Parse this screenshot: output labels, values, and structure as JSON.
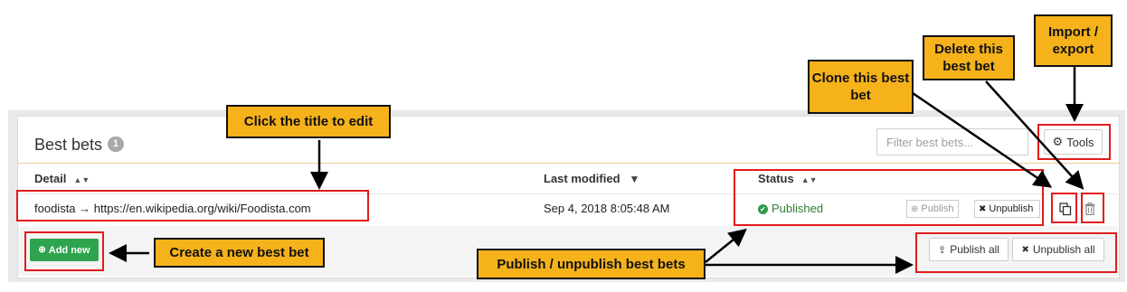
{
  "panel": {
    "title": "Best bets",
    "count": "1",
    "filter_placeholder": "Filter best bets...",
    "tools_label": "Tools"
  },
  "table": {
    "columns": [
      {
        "label": "Detail",
        "sort": "both"
      },
      {
        "label": "Last modified",
        "sort": "desc"
      },
      {
        "label": "Status",
        "sort": "both"
      }
    ],
    "rows": [
      {
        "detail": "foodista → https://en.wikipedia.org/wiki/Foodista.com",
        "last_modified": "Sep 4, 2018 8:05:48 AM",
        "status": "Published",
        "publish_label": "Publish",
        "unpublish_label": "Unpublish"
      }
    ]
  },
  "footer": {
    "add_new_label": "Add new",
    "publish_all_label": "Publish all",
    "unpublish_all_label": "Unpublish all"
  },
  "annotations": {
    "edit_title": "Click the title to edit",
    "clone": "Clone this best bet",
    "delete": "Delete this best bet",
    "import_export": "Import / export",
    "create_new": "Create a new best bet",
    "publish_unpublish": "Publish / unpublish best bets"
  },
  "colors": {
    "callout": "#f5b21b",
    "highlight_border": "#e21b1b",
    "add_button": "#2ea44f",
    "published": "#2e7d32"
  }
}
